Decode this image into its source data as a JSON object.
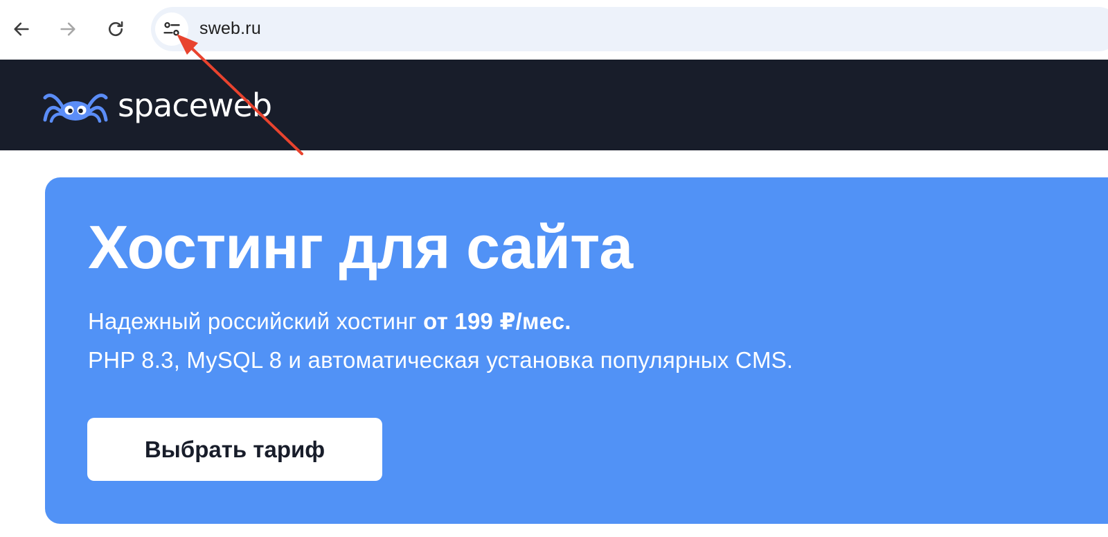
{
  "browser": {
    "url": "sweb.ru",
    "icons": {
      "back": "arrow-left-icon",
      "forward": "arrow-right-icon",
      "reload": "reload-icon",
      "site_info": "tune-icon"
    },
    "forward_disabled": true
  },
  "header": {
    "logo_text": "spaceweb"
  },
  "hero": {
    "title": "Хостинг для сайта",
    "line1_text": "Надежный российский хостинг ",
    "line1_bold": "от 199 ₽/мес.",
    "line2_text": "PHP 8.3, MySQL 8 и автоматическая установка популярных CMS.",
    "cta_label": "Выбрать тариф"
  },
  "colors": {
    "header_bg": "#181d2a",
    "hero_bg": "#5192f6",
    "logo_accent": "#5b8df7",
    "annotation_arrow": "#e8432e",
    "address_bar_bg": "#edf2fa"
  }
}
